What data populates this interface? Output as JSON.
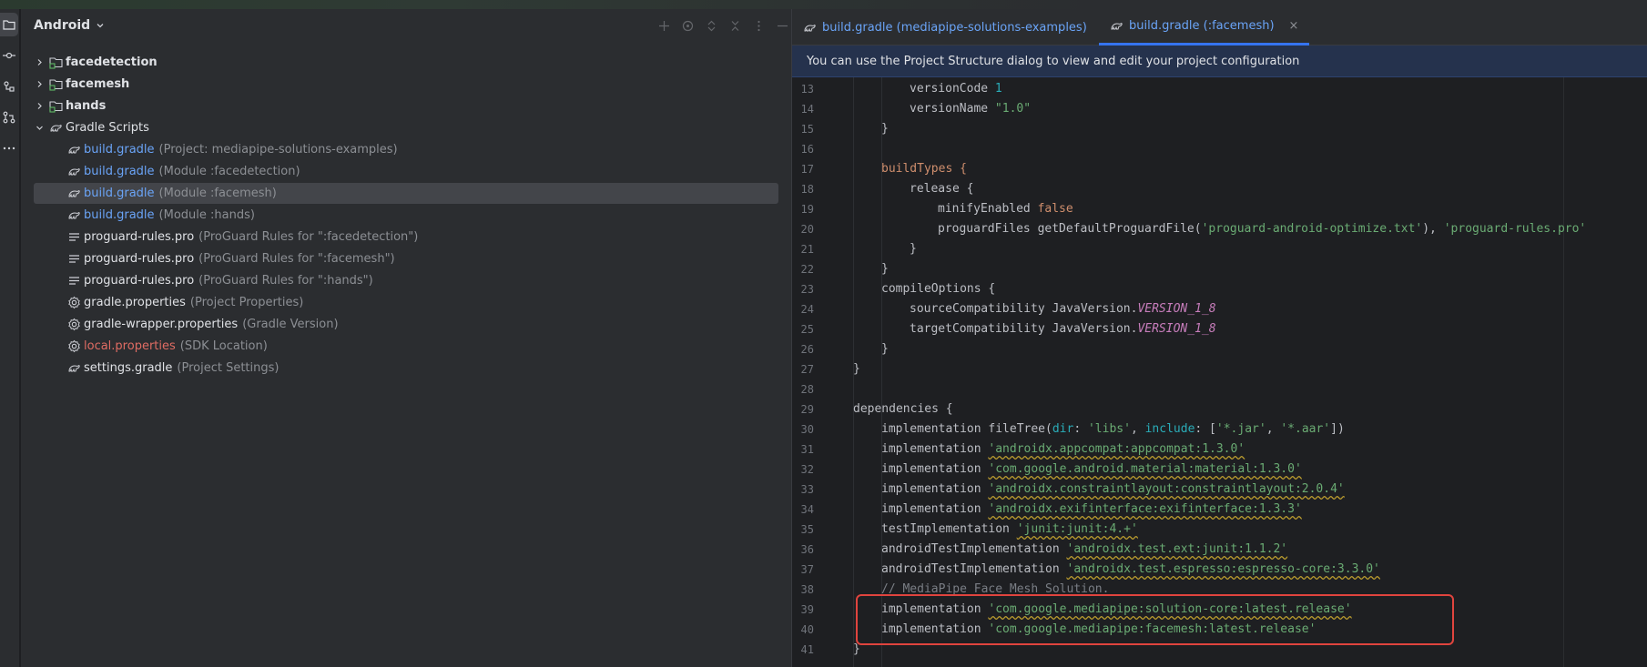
{
  "project_panel": {
    "title": "Android",
    "items": [
      {
        "label": "facedetection",
        "hint": ""
      },
      {
        "label": "facemesh",
        "hint": ""
      },
      {
        "label": "hands",
        "hint": ""
      },
      {
        "label": "Gradle Scripts",
        "hint": ""
      },
      {
        "label": "build.gradle",
        "hint": "(Project: mediapipe-solutions-examples)"
      },
      {
        "label": "build.gradle",
        "hint": "(Module :facedetection)"
      },
      {
        "label": "build.gradle",
        "hint": "(Module :facemesh)"
      },
      {
        "label": "build.gradle",
        "hint": "(Module :hands)"
      },
      {
        "label": "proguard-rules.pro",
        "hint": "(ProGuard Rules for \":facedetection\")"
      },
      {
        "label": "proguard-rules.pro",
        "hint": "(ProGuard Rules for \":facemesh\")"
      },
      {
        "label": "proguard-rules.pro",
        "hint": "(ProGuard Rules for \":hands\")"
      },
      {
        "label": "gradle.properties",
        "hint": "(Project Properties)"
      },
      {
        "label": "gradle-wrapper.properties",
        "hint": "(Gradle Version)"
      },
      {
        "label": "local.properties",
        "hint": "(SDK Location)"
      },
      {
        "label": "settings.gradle",
        "hint": "(Project Settings)"
      }
    ]
  },
  "editor": {
    "tabs": [
      {
        "label": "build.gradle (mediapipe-solutions-examples)"
      },
      {
        "label": "build.gradle (:facemesh)",
        "close": "×"
      }
    ],
    "banner": "You can use the Project Structure dialog to view and edit your project configuration",
    "line_numbers": [
      "13",
      "14",
      "15",
      "16",
      "17",
      "18",
      "19",
      "20",
      "21",
      "22",
      "23",
      "24",
      "25",
      "26",
      "27",
      "28",
      "29",
      "30",
      "31",
      "32",
      "33",
      "34",
      "35",
      "36",
      "37",
      "38",
      "39",
      "40",
      "41"
    ],
    "code": {
      "l13a": "versionCode ",
      "l13b": "1",
      "l14a": "versionName ",
      "l14b": "\"1.0\"",
      "l15": "}",
      "l17a": "buildTypes {",
      "l18": "release {",
      "l19a": "minifyEnabled ",
      "l19b": "false",
      "l20a": "proguardFiles getDefaultProguardFile(",
      "l20b": "'proguard-android-optimize.txt'",
      "l20c": "), ",
      "l20d": "'proguard-rules.pro'",
      "l21": "}",
      "l22": "}",
      "l23": "compileOptions {",
      "l24a": "sourceCompatibility JavaVersion.",
      "l24b": "VERSION_1_8",
      "l25a": "targetCompatibility JavaVersion.",
      "l25b": "VERSION_1_8",
      "l26": "}",
      "l27": "}",
      "l29": "dependencies {",
      "l30a": "implementation fileTree(",
      "l30b": "dir",
      "l30c": ": ",
      "l30d": "'libs'",
      "l30e": ", ",
      "l30f": "include",
      "l30g": ": [",
      "l30h": "'*.jar'",
      "l30i": ", ",
      "l30j": "'*.aar'",
      "l30k": "])",
      "l31a": "implementation ",
      "l31b": "'androidx.appcompat:appcompat:1.3.0'",
      "l32a": "implementation ",
      "l32b": "'com.google.android.material:material:1.3.0'",
      "l33a": "implementation ",
      "l33b": "'androidx.constraintlayout:constraintlayout:2.0.4'",
      "l34a": "implementation ",
      "l34b": "'androidx.exifinterface:exifinterface:1.3.3'",
      "l35a": "testImplementation ",
      "l35b": "'junit:junit:4.+'",
      "l36a": "androidTestImplementation ",
      "l36b": "'androidx.test.ext:junit:1.1.2'",
      "l37a": "androidTestImplementation ",
      "l37b": "'androidx.test.espresso:espresso-core:3.3.0'",
      "l38": "// MediaPipe Face Mesh Solution.",
      "l39a": "implementation ",
      "l39b": "'com.google.mediapipe:solution-core:latest.release'",
      "l40a": "implementation ",
      "l40b": "'com.google.mediapipe:facemesh:latest.release'",
      "l41": "}"
    }
  },
  "colors": {
    "accent": "#3574f0",
    "highlight_box": "#e0443e",
    "string": "#6aab73",
    "keyword": "#cf8e6d",
    "number": "#2aacb8",
    "constant": "#c77dbb"
  },
  "icons": [
    "project-folder-icon",
    "commit-icon",
    "structure-icon",
    "pull-requests-icon",
    "more-icon",
    "folder-module-icon",
    "gradle-icon",
    "text-file-icon",
    "settings-file-icon",
    "chevron-down-icon",
    "chevron-right-icon",
    "close-icon"
  ]
}
